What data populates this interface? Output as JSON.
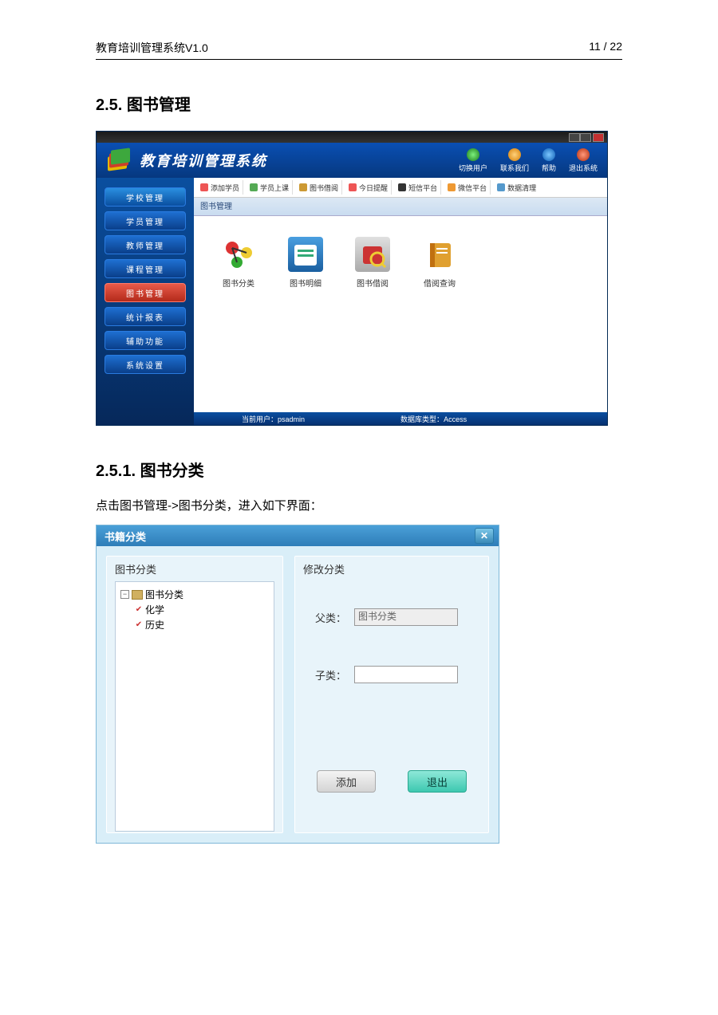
{
  "doc": {
    "header_left": "教育培训管理系统V1.0",
    "header_right": "11 / 22",
    "section_2_5": "2.5. 图书管理",
    "section_2_5_1": "2.5.1. 图书分类",
    "para_2_5_1": "点击图书管理->图书分类，进入如下界面："
  },
  "app": {
    "title": "教育培训管理系统",
    "header_icons": [
      {
        "label": "切换用户",
        "color": "c-green"
      },
      {
        "label": "联系我们",
        "color": "c-orange"
      },
      {
        "label": "帮助",
        "color": "c-blue"
      },
      {
        "label": "退出系统",
        "color": "c-red"
      }
    ],
    "sidebar": {
      "top": "学校管理",
      "items": [
        "学员管理",
        "教师管理",
        "课程管理",
        "图书管理",
        "统计报表",
        "辅助功能",
        "系统设置"
      ],
      "active_index": 3
    },
    "toolbar": [
      {
        "label": "添加学员",
        "color": "#e55"
      },
      {
        "label": "学员上课",
        "color": "#5a5"
      },
      {
        "label": "图书借阅",
        "color": "#c93"
      },
      {
        "label": "今日提醒",
        "color": "#e55"
      },
      {
        "label": "短信平台",
        "color": "#333"
      },
      {
        "label": "微信平台",
        "color": "#e93"
      },
      {
        "label": "数据清理",
        "color": "#59c"
      }
    ],
    "content_header": "图书管理",
    "modules": [
      {
        "label": "图书分类"
      },
      {
        "label": "图书明细"
      },
      {
        "label": "图书借阅"
      },
      {
        "label": "借阅查询"
      }
    ],
    "status": {
      "user_label": "当前用户：",
      "user": "psadmin",
      "db_label": "数据库类型：",
      "db": "Access"
    }
  },
  "dialog": {
    "title": "书籍分类",
    "left_label": "图书分类",
    "right_label": "修改分类",
    "tree": {
      "root": "图书分类",
      "children": [
        "化学",
        "历史"
      ]
    },
    "form": {
      "parent_label": "父类：",
      "parent_value": "图书分类",
      "child_label": "子类：",
      "child_value": ""
    },
    "buttons": {
      "add": "添加",
      "exit": "退出"
    }
  }
}
